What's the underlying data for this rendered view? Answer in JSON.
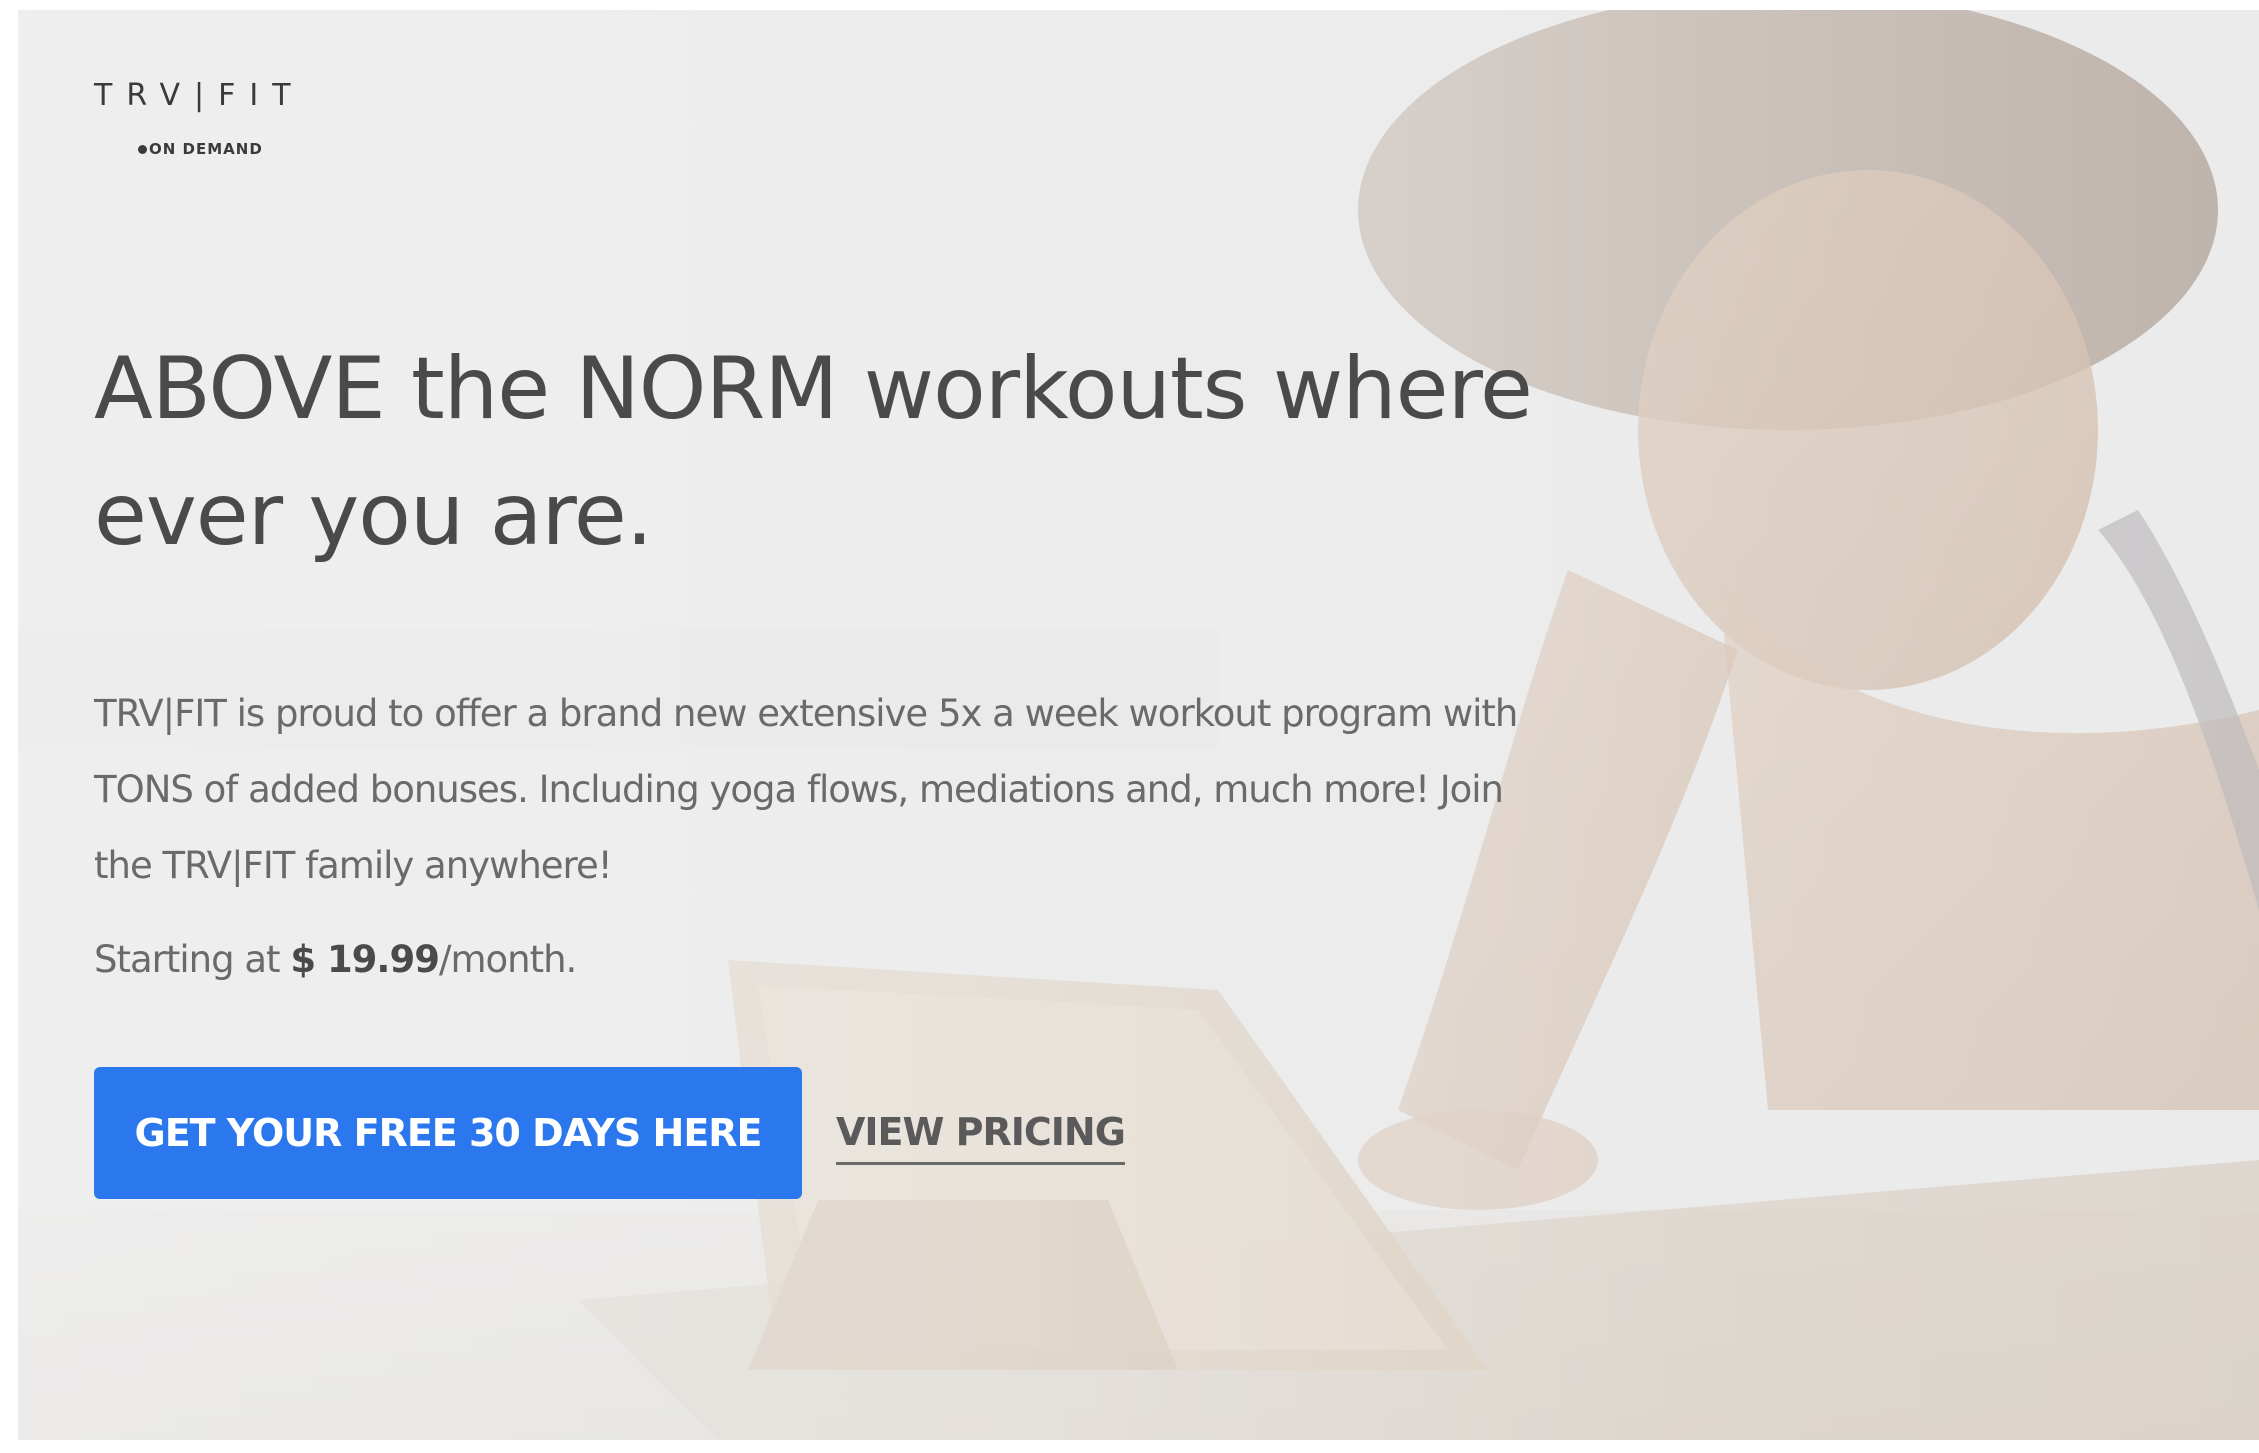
{
  "brand": {
    "logo_main": "TRV|FIT",
    "logo_sub": "ON DEMAND"
  },
  "hero": {
    "headline_line1": "ABOVE the NORM workouts where",
    "headline_line2": "ever you are.",
    "body_line1": "TRV|FIT is proud to offer a brand new extensive 5x a week workout program with",
    "body_line2": "TONS of added bonuses. Including yoga flows, mediations and, much more! Join",
    "body_line3": "the TRV|FIT family anywhere!",
    "price_prefix": "Starting at ",
    "price_amount": "$ 19.99",
    "price_suffix": "/month."
  },
  "actions": {
    "primary_label": "GET YOUR FREE 30 DAYS HERE",
    "secondary_label": "VIEW PRICING"
  },
  "colors": {
    "primary_button": "#2b78ee",
    "headline_text": "#4a4a4a",
    "body_text": "#6a6a6a"
  },
  "images": {
    "background": "woman-doing-plank-with-tablet-photo"
  }
}
